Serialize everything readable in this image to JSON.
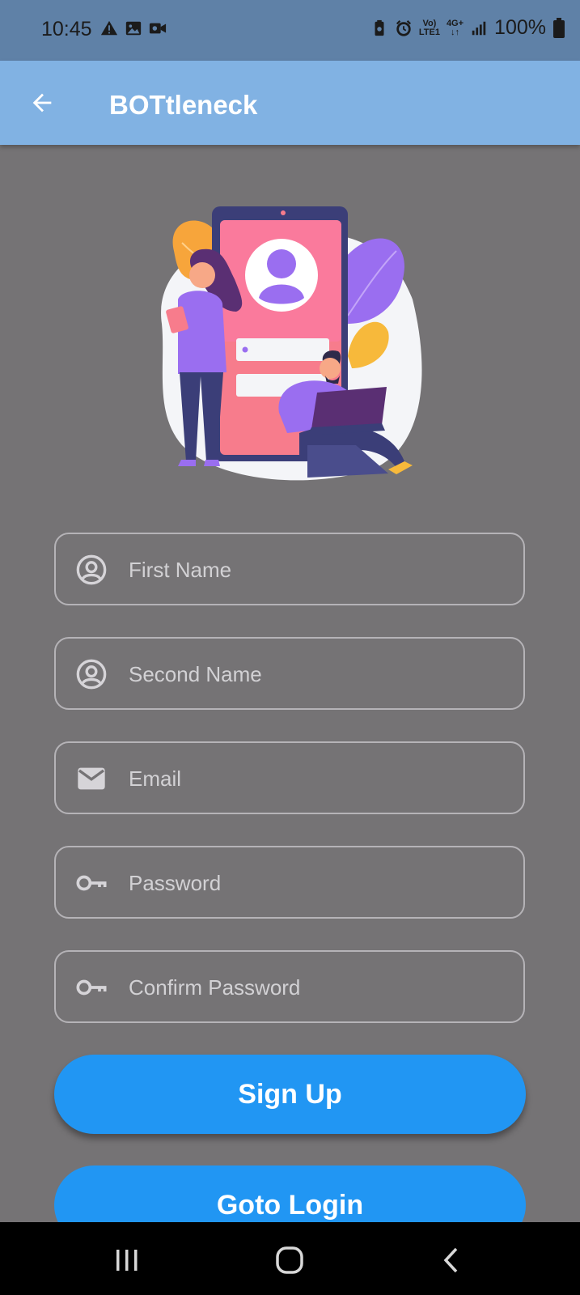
{
  "status_bar": {
    "time": "10:45",
    "left_icons": [
      "warning-icon",
      "image-icon",
      "video-icon"
    ],
    "network_top": "Vo)",
    "network_bottom": "LTE1",
    "network_type": "4G+",
    "battery_percent": "100%"
  },
  "app_bar": {
    "title": "BOTtleneck",
    "back_icon": "arrow-back-icon",
    "background_color": "#81b2e3"
  },
  "form": {
    "fields": [
      {
        "placeholder": "First Name",
        "icon": "account-circle-icon"
      },
      {
        "placeholder": "Second Name",
        "icon": "account-circle-icon"
      },
      {
        "placeholder": "Email",
        "icon": "mail-icon"
      },
      {
        "placeholder": "Password",
        "icon": "key-icon"
      },
      {
        "placeholder": "Confirm Password",
        "icon": "key-icon"
      }
    ]
  },
  "buttons": {
    "sign_up": "Sign Up",
    "goto_login": "Goto Login",
    "color": "#2196f3"
  },
  "nav_bar": {
    "items": [
      "recents-icon",
      "home-icon",
      "back-icon"
    ]
  }
}
